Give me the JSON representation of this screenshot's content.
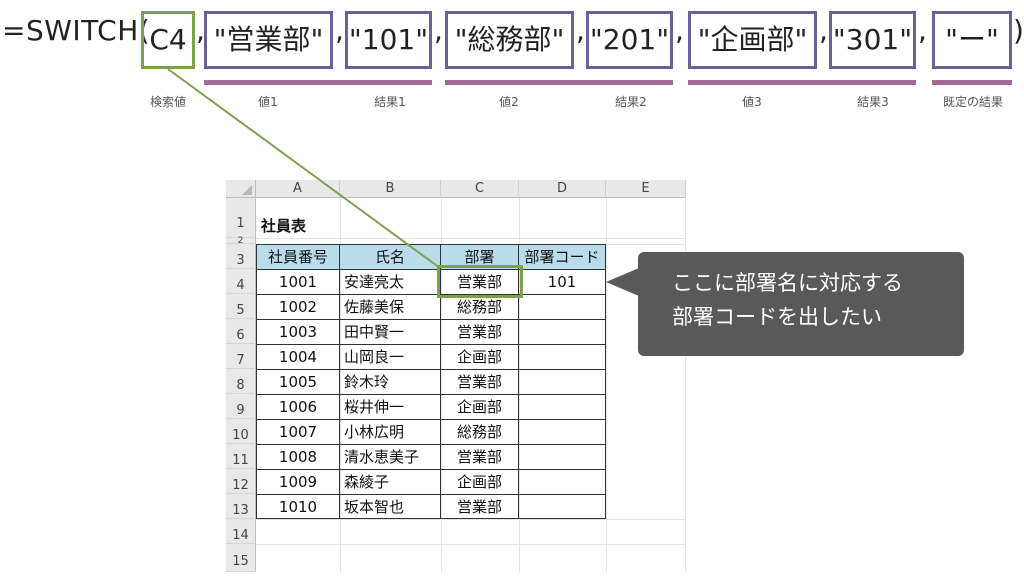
{
  "formula": {
    "prefix": "=SWITCH(",
    "lookup": "C4",
    "comma": ",",
    "val1": "\"営業部\"",
    "res1": "\"101\"",
    "val2": "\"総務部\"",
    "res2": "\"201\"",
    "val3": "\"企画部\"",
    "res3": "\"301\"",
    "default": "\"ー\"",
    "suffix": ")"
  },
  "captions": {
    "lookup": "検索値",
    "val1": "値1",
    "res1": "結果1",
    "val2": "値2",
    "res2": "結果2",
    "val3": "値3",
    "res3": "結果3",
    "default": "既定の結果"
  },
  "colors": {
    "value_box": "#6b5f99",
    "lookup_box": "#7ba14d",
    "underline": "#a36a96",
    "header_fill": "#b9dcea",
    "callout_bg": "#595959"
  },
  "sheet": {
    "columns": [
      "A",
      "B",
      "C",
      "D",
      "E"
    ],
    "rows": [
      "1",
      "2",
      "3",
      "4",
      "5",
      "6",
      "7",
      "8",
      "9",
      "10",
      "11",
      "12",
      "13",
      "14",
      "15"
    ],
    "title": "社員表",
    "headers": [
      "社員番号",
      "氏名",
      "部署",
      "部署コード"
    ],
    "data": [
      [
        "1001",
        "安達亮太",
        "営業部",
        "101"
      ],
      [
        "1002",
        "佐藤美保",
        "総務部",
        ""
      ],
      [
        "1003",
        "田中賢一",
        "営業部",
        ""
      ],
      [
        "1004",
        "山岡良一",
        "企画部",
        ""
      ],
      [
        "1005",
        "鈴木玲",
        "営業部",
        ""
      ],
      [
        "1006",
        "桜井伸一",
        "企画部",
        ""
      ],
      [
        "1007",
        "小林広明",
        "総務部",
        ""
      ],
      [
        "1008",
        "清水恵美子",
        "営業部",
        ""
      ],
      [
        "1009",
        "森綾子",
        "企画部",
        ""
      ],
      [
        "1010",
        "坂本智也",
        "営業部",
        ""
      ]
    ]
  },
  "callout": {
    "line1": "ここに部署名に対応する",
    "line2": "部署コードを出したい"
  }
}
